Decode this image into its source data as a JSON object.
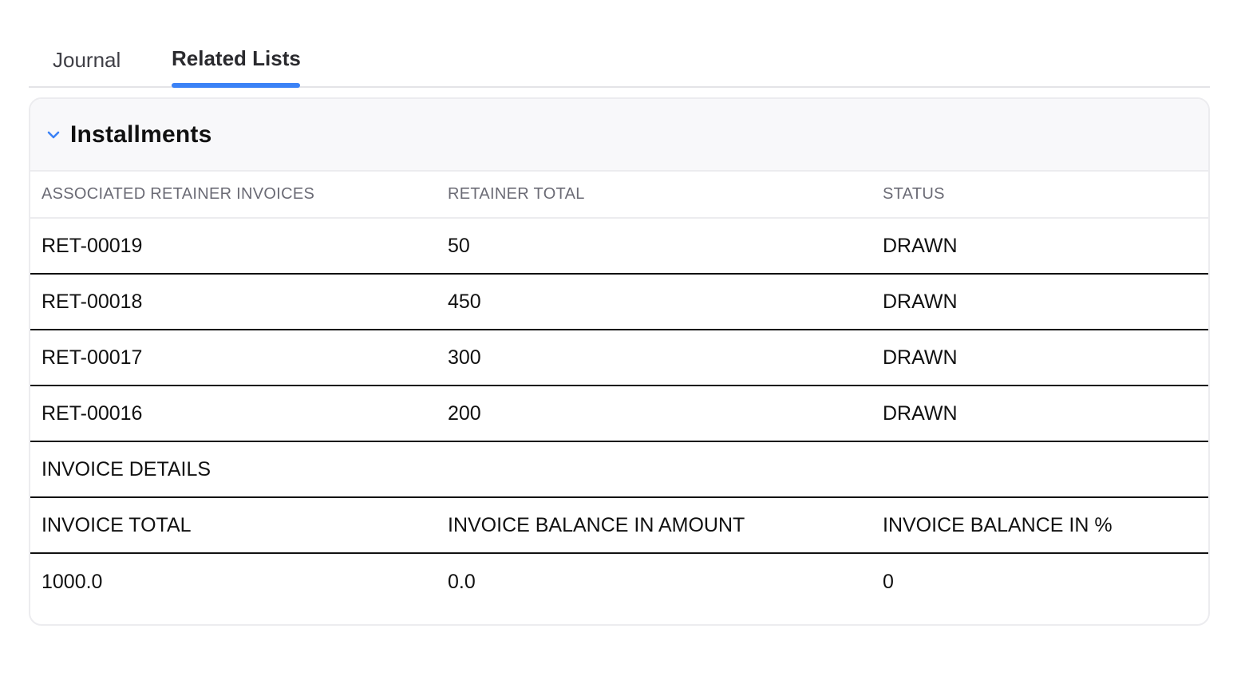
{
  "tabs": [
    {
      "label": "Journal",
      "active": false
    },
    {
      "label": "Related Lists",
      "active": true
    }
  ],
  "accent_color": "#3b82f6",
  "section": {
    "title": "Installments",
    "collapse_icon": "chevron-down-icon",
    "columns": [
      "ASSOCIATED RETAINER INVOICES",
      "RETAINER TOTAL",
      "STATUS"
    ],
    "rows": [
      [
        "RET-00019",
        "50",
        "DRAWN"
      ],
      [
        "RET-00018",
        "450",
        "DRAWN"
      ],
      [
        "RET-00017",
        "300",
        "DRAWN"
      ],
      [
        "RET-00016",
        "200",
        "DRAWN"
      ]
    ],
    "invoice_details_label": "INVOICE DETAILS",
    "invoice_columns": [
      "INVOICE TOTAL",
      "INVOICE BALANCE IN AMOUNT",
      "INVOICE BALANCE IN %"
    ],
    "invoice_values": [
      "1000.0",
      "0.0",
      "0"
    ]
  }
}
